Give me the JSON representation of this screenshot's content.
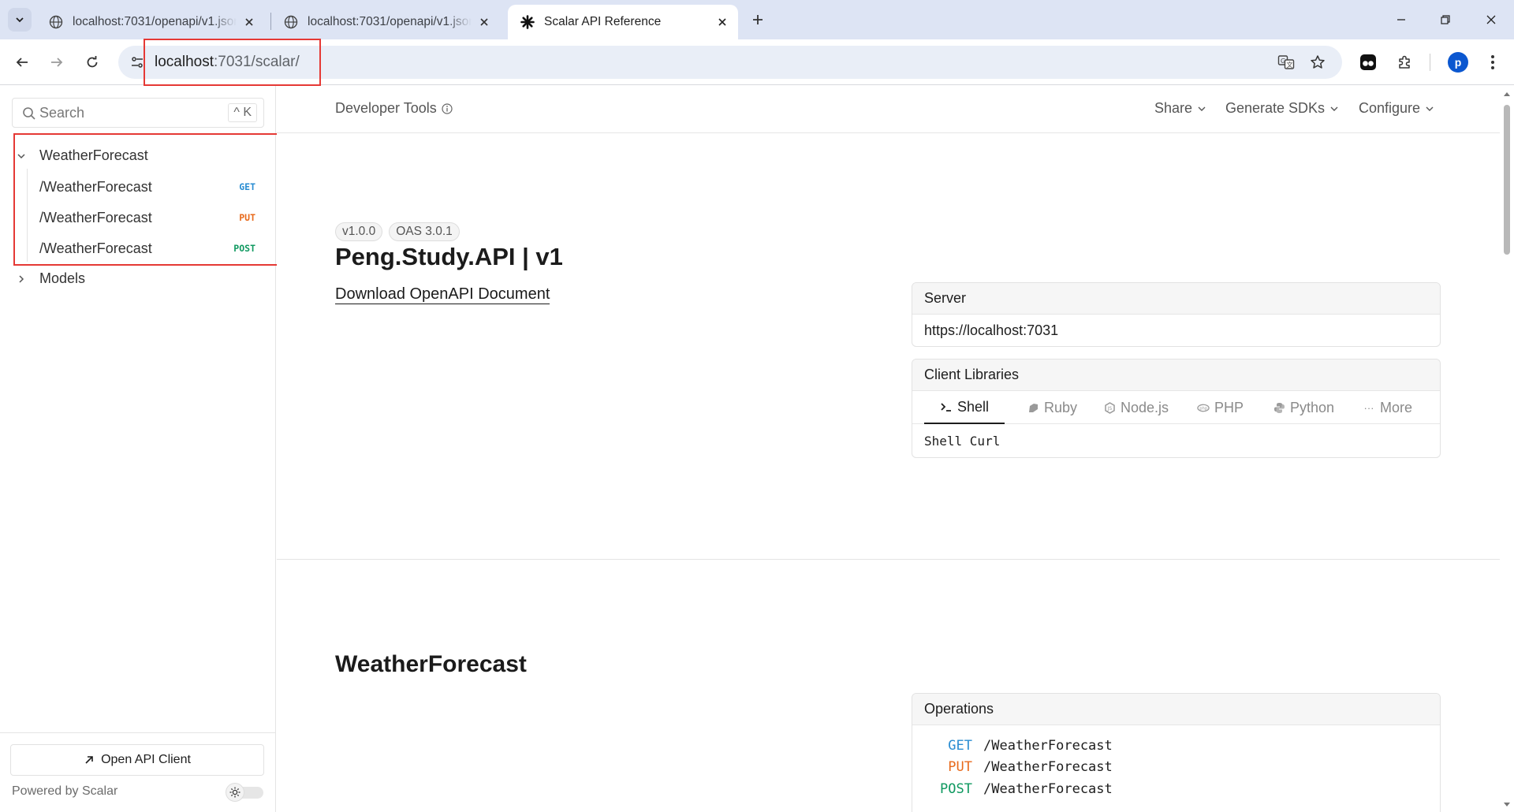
{
  "browser": {
    "tabs": [
      {
        "title": "localhost:7031/openapi/v1.json",
        "active": false,
        "favicon": "globe-icon"
      },
      {
        "title": "localhost:7031/openapi/v1.json",
        "active": false,
        "favicon": "globe-icon"
      },
      {
        "title": "Scalar API Reference",
        "active": true,
        "favicon": "scalar-logo-icon"
      }
    ],
    "address": {
      "host": "localhost",
      "rest": ":7031/scalar/"
    },
    "profile_initial": "p",
    "colors": {
      "tabstrip": "#dde4f4",
      "highlight": "#e53935",
      "profile": "#0b57d0"
    }
  },
  "sidebar": {
    "search_placeholder": "Search",
    "search_shortcut": "^ K",
    "groups": [
      {
        "label": "WeatherForecast",
        "expanded": true,
        "items": [
          {
            "path": "/WeatherForecast",
            "method": "GET"
          },
          {
            "path": "/WeatherForecast",
            "method": "PUT"
          },
          {
            "path": "/WeatherForecast",
            "method": "POST"
          }
        ]
      },
      {
        "label": "Models",
        "expanded": false
      }
    ],
    "open_client_label": "Open API Client",
    "powered_by": "Powered by Scalar"
  },
  "header": {
    "title": "Developer Tools",
    "menus": [
      "Share",
      "Generate SDKs",
      "Configure"
    ]
  },
  "intro": {
    "version_badge": "v1.0.0",
    "oas_badge": "OAS 3.0.1",
    "title": "Peng.Study.API | v1",
    "download_link": "Download OpenAPI Document"
  },
  "server_card": {
    "heading": "Server",
    "url": "https://localhost:7031"
  },
  "client_libraries": {
    "heading": "Client Libraries",
    "tabs": [
      {
        "label": "Shell",
        "icon": "terminal-icon",
        "active": true
      },
      {
        "label": "Ruby",
        "icon": "ruby-icon",
        "active": false
      },
      {
        "label": "Node.js",
        "icon": "nodejs-icon",
        "active": false
      },
      {
        "label": "PHP",
        "icon": "php-icon",
        "active": false
      },
      {
        "label": "Python",
        "icon": "python-icon",
        "active": false
      },
      {
        "label": "More",
        "icon": "more-icon",
        "active": false
      }
    ],
    "selected_client": "Shell Curl"
  },
  "tag_section": {
    "title": "WeatherForecast",
    "operations_heading": "Operations",
    "operations": [
      {
        "method": "GET",
        "path": "/WeatherForecast"
      },
      {
        "method": "PUT",
        "path": "/WeatherForecast"
      },
      {
        "method": "POST",
        "path": "/WeatherForecast"
      }
    ]
  },
  "method_colors": {
    "GET": "#2a8dd2",
    "PUT": "#e86a1c",
    "POST": "#0f9960"
  }
}
